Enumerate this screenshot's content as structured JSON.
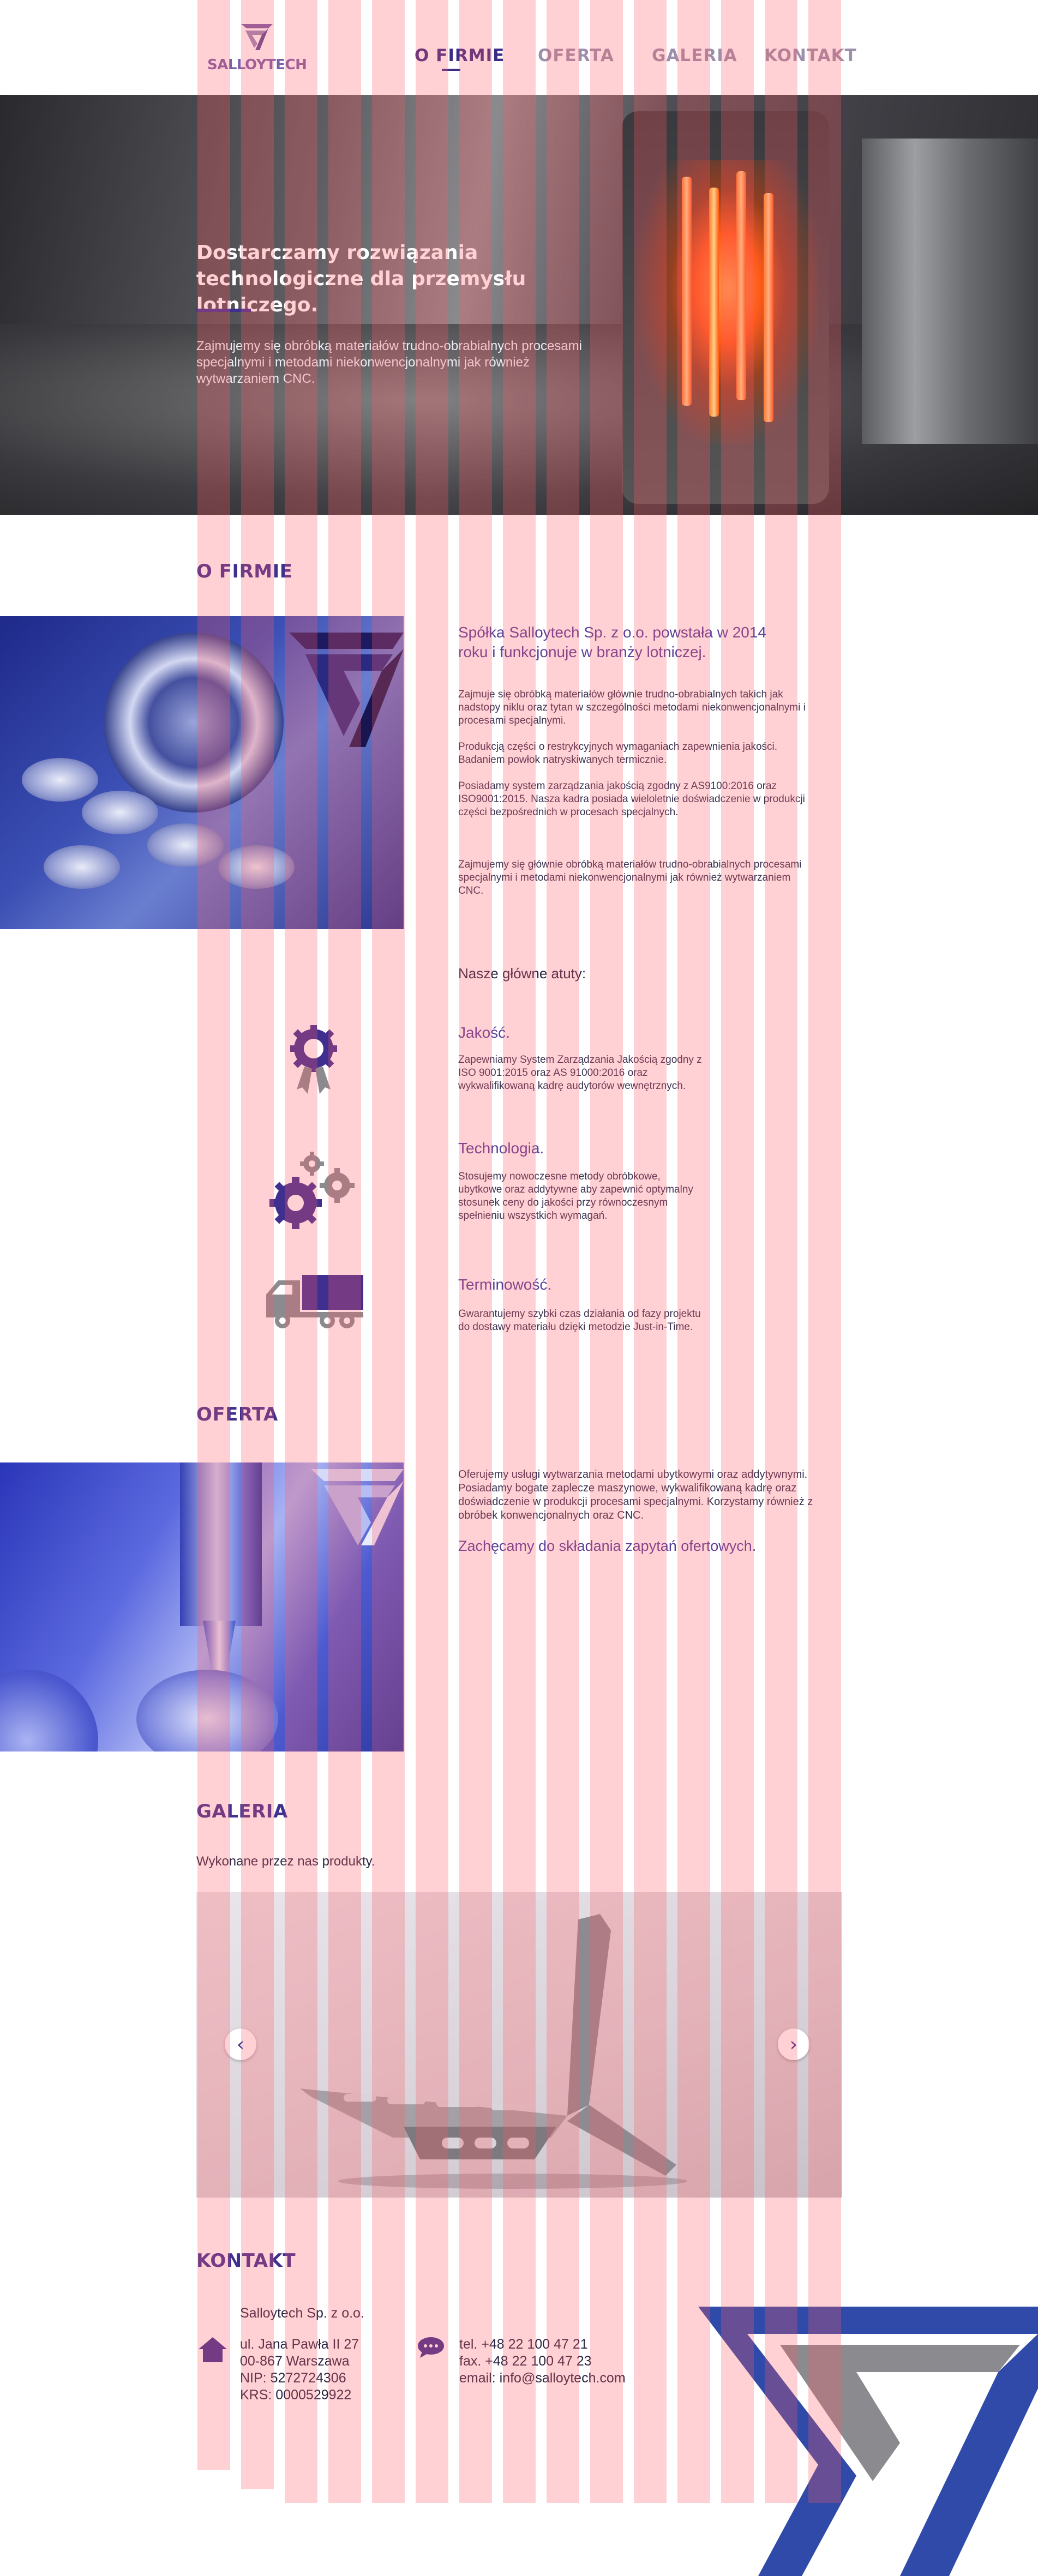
{
  "header": {
    "logo_text": "SALLOYTECH",
    "nav": [
      {
        "label": "O FIRMIE",
        "active": true
      },
      {
        "label": "OFERTA",
        "active": false
      },
      {
        "label": "GALERIA",
        "active": false
      },
      {
        "label": "KONTAKT",
        "active": false
      }
    ]
  },
  "hero": {
    "title": "Dostarczamy rozwiązania technologiczne dla przemysłu lotniczego.",
    "subtitle": "Zajmujemy się obróbką materiałów trudno-obrabialnych procesami specjalnymi i metodami niekonwencjonalnymi jak również wytwarzaniem CNC."
  },
  "firmie": {
    "title": "O FIRMIE",
    "lead": "Spółka Salloytech Sp. z o.o. powstała w 2014 roku i funkcjonuje w branży lotniczej.",
    "paragraphs": [
      "Zajmuje się obróbką materiałów głównie trudno-obrabialnych takich jak nadstopy niklu oraz tytan w szczególności metodami niekonwencjonalnymi i procesami specjalnymi.",
      "Produkcją części o restrykcyjnych wymaganiach zapewnienia jakości. Badaniem powłok natryskiwanych termicznie.",
      "Posiadamy system zarządzania jakością zgodny z AS9100:2016 oraz ISO9001:2015. Nasza kadra posiada wieloletnie doświadczenie w produkcji części bezpośrednich w procesach specjalnych.",
      "Zajmujemy się głównie obróbką materiałów trudno-obrabialnych procesami specjalnymi i metodami niekonwencjonalnymi jak również wytwarzaniem CNC."
    ],
    "atuty_title": "Nasze główne atuty:",
    "atuty": [
      {
        "icon": "quality-award-icon",
        "title": "Jakość.",
        "text": "Zapewniamy System Zarządzania Jakością zgodny z ISO 9001:2015 oraz AS 91000:2016 oraz wykwalifikowaną kadrę audytorów wewnętrznych."
      },
      {
        "icon": "gears-icon",
        "title": "Technologia.",
        "text": "Stosujemy nowoczesne metody obróbkowe, ubytkowe oraz addytywne aby zapewnić optymalny stosunek ceny do jakości przy równoczesnym spełnieniu wszystkich wymagań."
      },
      {
        "icon": "delivery-truck-icon",
        "title": "Terminowość.",
        "text": "Gwarantujemy szybki czas działania od fazy projektu do dostawy materiału dzięki metodzie Just-in-Time."
      }
    ]
  },
  "oferta": {
    "title": "OFERTA",
    "body": "Oferujemy usługi wytwarzania metodami ubytkowymi oraz addytywnymi. Posiadamy bogate zaplecze maszynowe, wykwalifikowaną kadrę oraz doświadczenie w produkcji procesami specjalnymi. Korzystamy również z obróbek konwencjonalnych oraz CNC.",
    "cta": "Zachęcamy do składania zapytań ofertowych."
  },
  "galeria": {
    "title": "GALERIA",
    "subtitle": "Wykonane przez nas produkty."
  },
  "kontakt": {
    "title": "KONTAKT",
    "company": "Salloytech Sp. z o.o.",
    "address_lines": [
      "ul. Jana Pawła II 27",
      "00-867 Warszawa",
      "NIP: 5272724306",
      "KRS: 0000529922"
    ],
    "contact_lines": [
      "tel. +48 22 100 47 21",
      "fax. +48 22 100 47 23",
      "email: info@salloytech.com"
    ]
  },
  "colors": {
    "brand_purple": "#3f2f8f",
    "accent_violet": "#5a3e9a",
    "overlay_pink": "#ff5a64",
    "logo_blue": "#2f4aa8",
    "logo_grey": "#8a8a8f"
  }
}
